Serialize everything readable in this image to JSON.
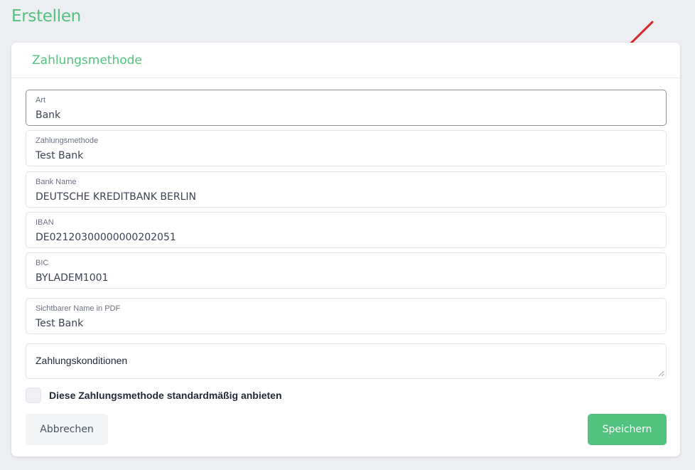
{
  "page": {
    "title": "Erstellen"
  },
  "card": {
    "title": "Zahlungsmethode"
  },
  "fields": [
    {
      "label": "Art",
      "value": "Bank"
    },
    {
      "label": "Zahlungsmethode",
      "value": "Test Bank"
    },
    {
      "label": "Bank Name",
      "value": "DEUTSCHE KREDITBANK BERLIN"
    },
    {
      "label": "IBAN",
      "value": "DE02120300000000202051"
    },
    {
      "label": "BIC",
      "value": "BYLADEM1001"
    },
    {
      "label": "Sichtbarer Name in PDF",
      "value": "Test Bank"
    }
  ],
  "conditions": {
    "placeholder": "Zahlungskonditionen"
  },
  "default_option": {
    "label": "Diese Zahlungsmethode standardmäßig anbieten",
    "checked": false
  },
  "buttons": {
    "cancel": "Abbrechen",
    "save": "Speichern"
  },
  "colors": {
    "accent": "#52c27e",
    "annotation_arrow": "#d42a2a"
  }
}
